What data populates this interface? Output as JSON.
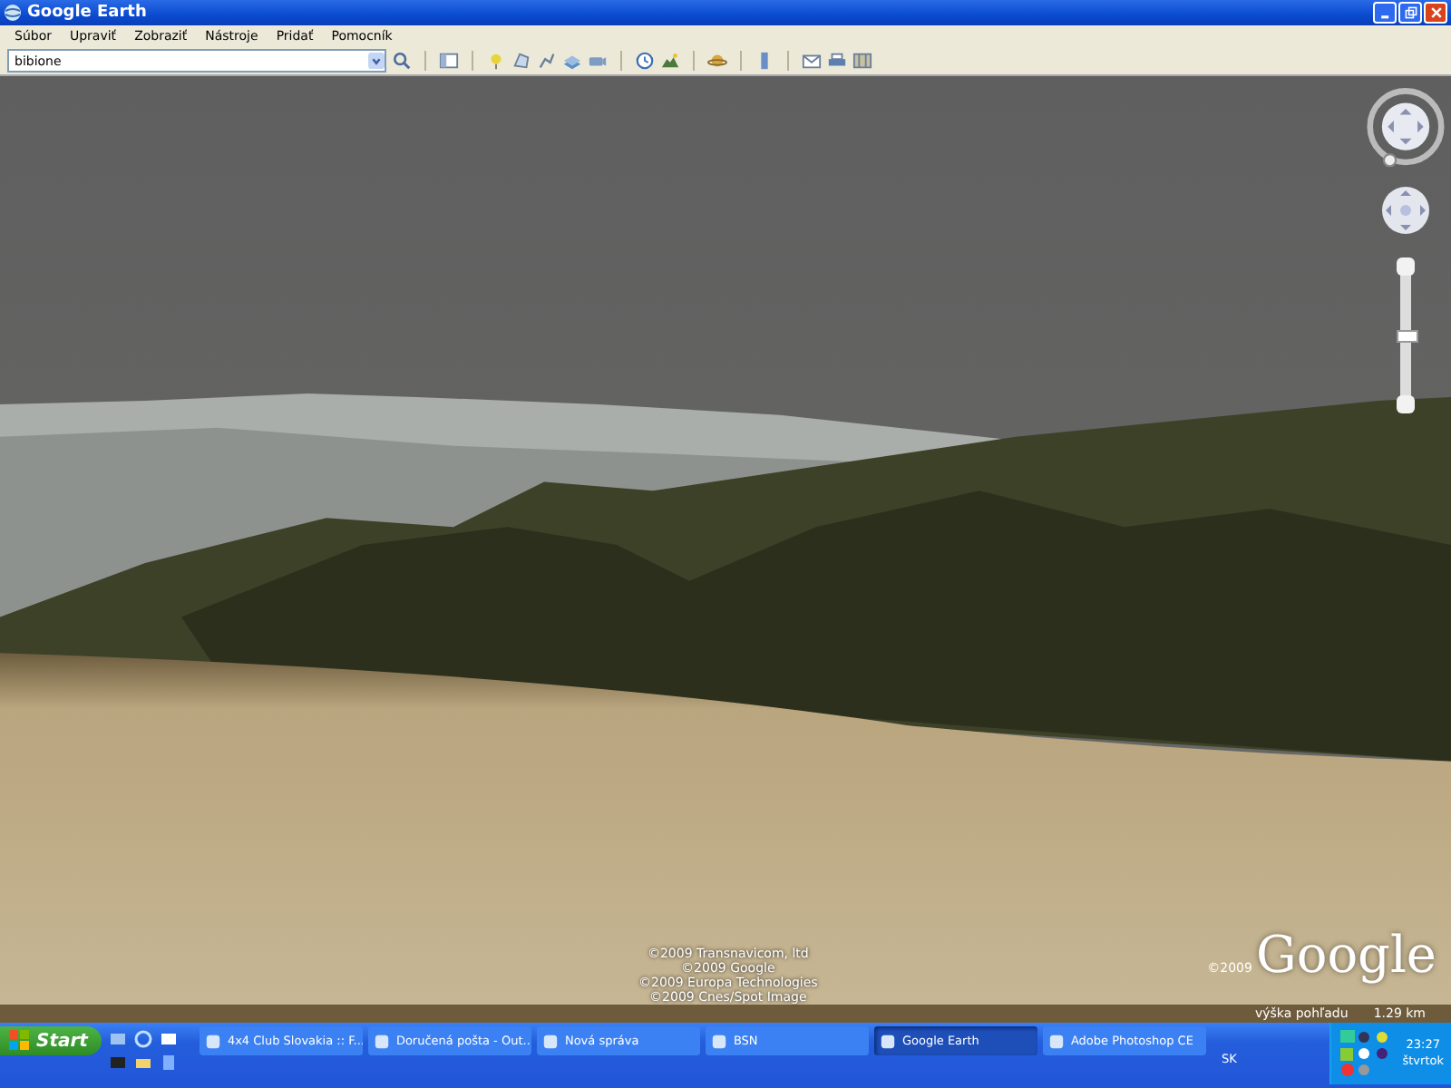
{
  "window": {
    "title": "Google Earth"
  },
  "menu": [
    "Súbor",
    "Upraviť",
    "Zobraziť",
    "Nástroje",
    "Pridať",
    "Pomocník"
  ],
  "search": {
    "value": "bibione"
  },
  "view": {
    "attributions": [
      "©2009 Transnavicom, ltd",
      "©2009 Google",
      "©2009 Europa Technologies",
      "©2009 Cnes/Spot Image"
    ],
    "logo_year": "©2009",
    "logo": "Google",
    "altitude_label": "výška pohľadu",
    "altitude": "1.29 km",
    "zoom": {
      "level": 0.5
    }
  },
  "taskbar": {
    "start": "Start",
    "tasks": [
      {
        "label": "4x4 Club Slovakia :: F...",
        "selected": false
      },
      {
        "label": "Doručená pošta - Out...",
        "selected": false
      },
      {
        "label": "Nová správa",
        "selected": false
      },
      {
        "label": "BSN",
        "selected": false
      },
      {
        "label": "Google Earth",
        "selected": true
      },
      {
        "label": "Adobe Photoshop CE",
        "selected": false
      }
    ],
    "language": "SK",
    "time": "23:27",
    "day": "štvrtok"
  }
}
